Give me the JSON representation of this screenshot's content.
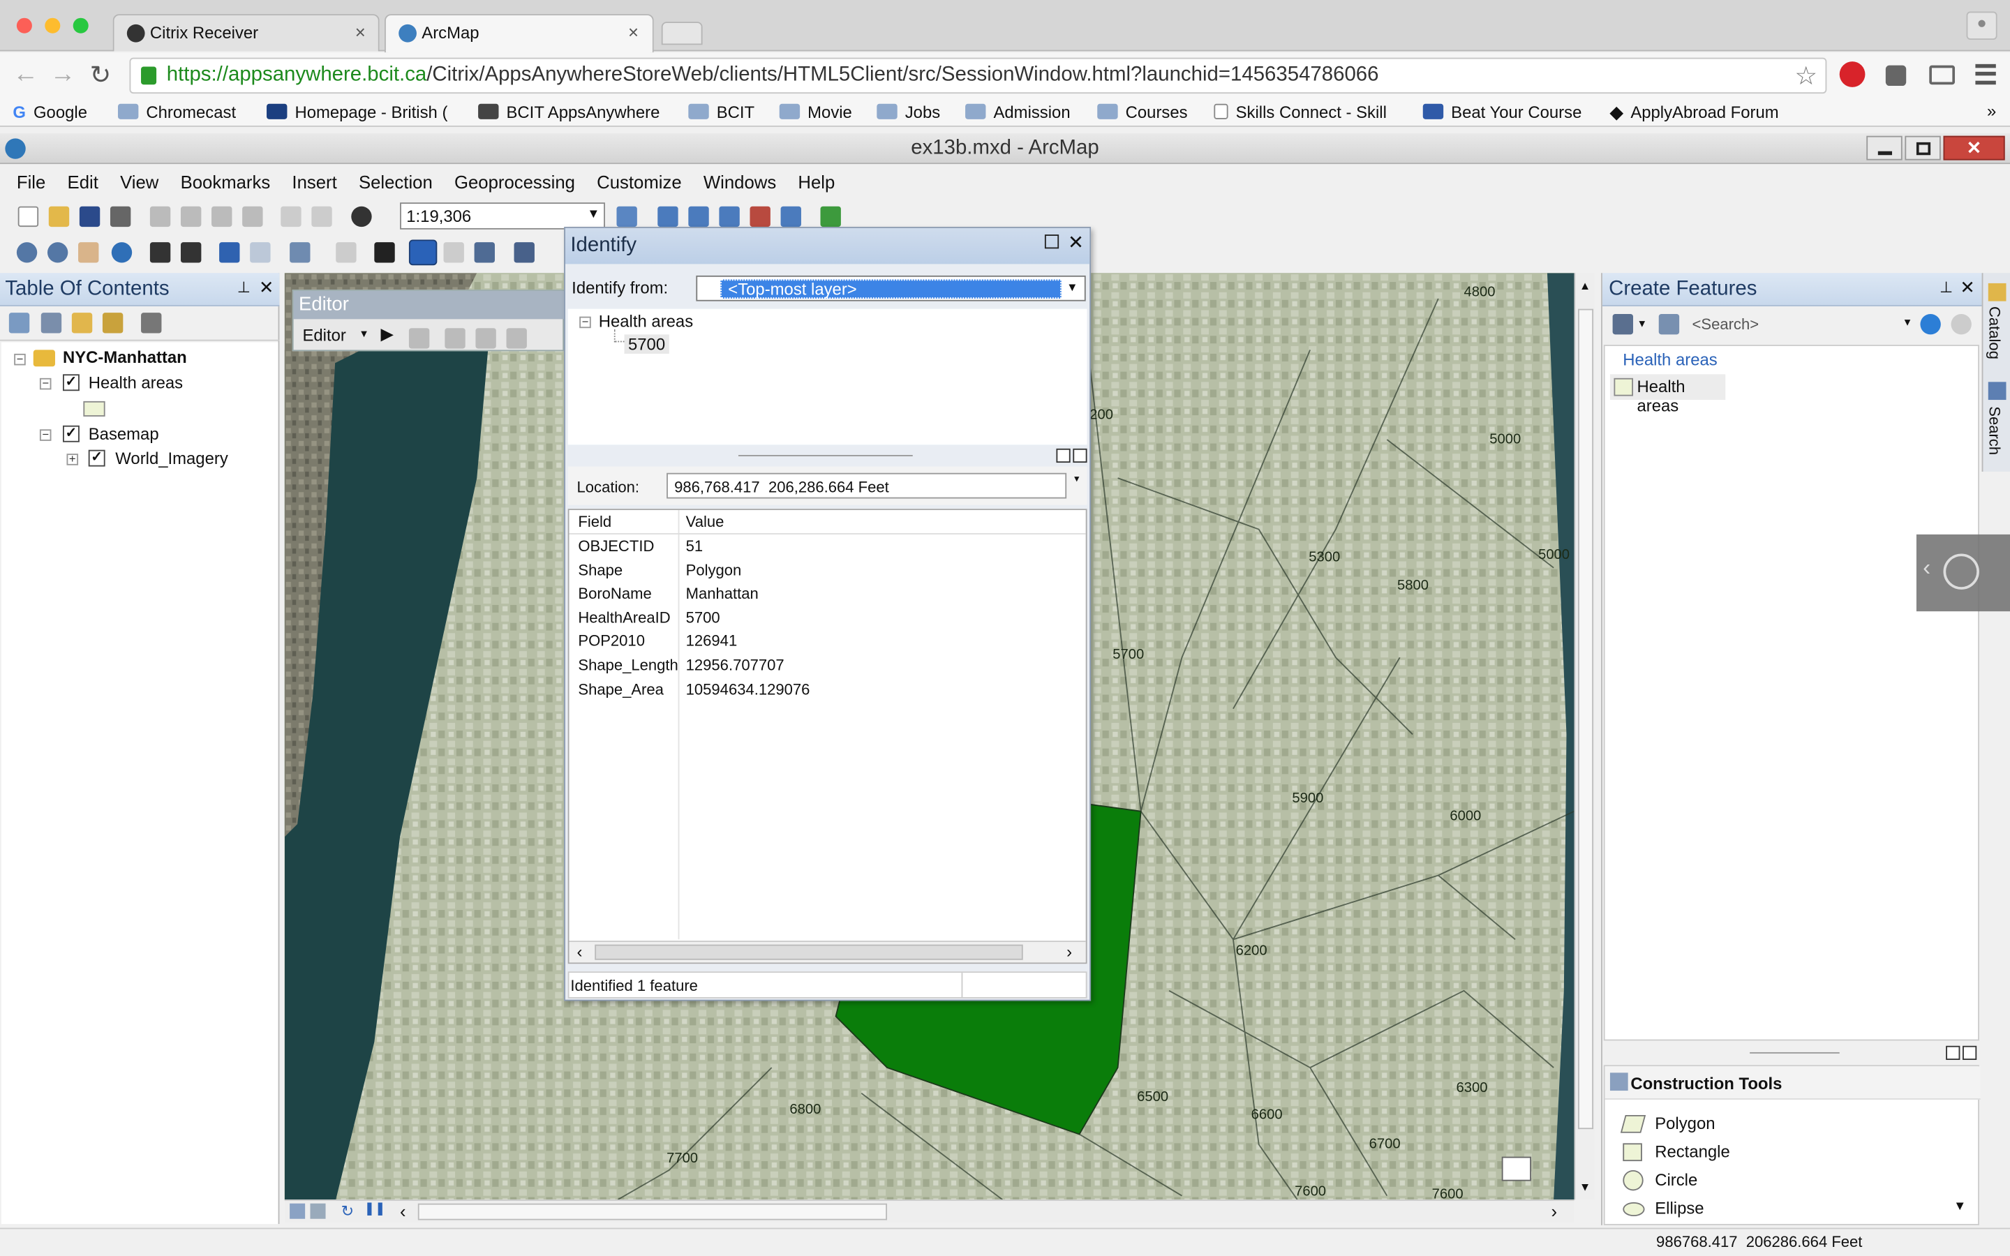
{
  "browser": {
    "tabs": [
      {
        "title": "Citrix Receiver"
      },
      {
        "title": "ArcMap"
      }
    ],
    "url_host": "https://appsanywhere.bcit.ca",
    "url_path": "/Citrix/AppsAnywhereStoreWeb/clients/HTML5Client/src/SessionWindow.html?launchid=1456354786066",
    "bookmarks": [
      "Google",
      "Chromecast",
      "Homepage - British (",
      "BCIT AppsAnywhere",
      "BCIT",
      "Movie",
      "Jobs",
      "Admission",
      "Courses",
      "Skills Connect - Skill",
      "Beat Your Course",
      "ApplyAbroad Forum"
    ]
  },
  "window": {
    "title": "ex13b.mxd - ArcMap"
  },
  "menu": [
    "File",
    "Edit",
    "View",
    "Bookmarks",
    "Insert",
    "Selection",
    "Geoprocessing",
    "Customize",
    "Windows",
    "Help"
  ],
  "toolbar": {
    "scale": "1:19,306"
  },
  "toc": {
    "title": "Table Of Contents",
    "root": "NYC-Manhattan",
    "layer1": "Health areas",
    "group": "Basemap",
    "layer2": "World_Imagery"
  },
  "editor": {
    "title": "Editor",
    "menu": "Editor"
  },
  "identify": {
    "title": "Identify",
    "from_label": "Identify from:",
    "from_value": "<Top-most layer>",
    "tree_layer": "Health areas",
    "tree_feature": "5700",
    "location_label": "Location:",
    "location_value": "986,768.417  206,286.664 Feet",
    "col_field": "Field",
    "col_value": "Value",
    "rows": [
      {
        "field": "OBJECTID",
        "value": "51"
      },
      {
        "field": "Shape",
        "value": "Polygon"
      },
      {
        "field": "BoroName",
        "value": "Manhattan"
      },
      {
        "field": "HealthAreaID",
        "value": "5700"
      },
      {
        "field": "POP2010",
        "value": "126941"
      },
      {
        "field": "Shape_Length",
        "value": "12956.707707"
      },
      {
        "field": "Shape_Area",
        "value": "10594634.129076"
      }
    ],
    "status": "Identified 1 feature"
  },
  "map_labels": [
    "4800",
    "200",
    "5000",
    "5300",
    "5800",
    "5000",
    "5700",
    "5900",
    "6000",
    "6200",
    "6500",
    "6600",
    "6300",
    "6800",
    "6700",
    "7700",
    "7600",
    "7600"
  ],
  "create_features": {
    "title": "Create Features",
    "search_placeholder": "<Search>",
    "group": "Health areas",
    "template": "Health areas",
    "construction_title": "Construction Tools",
    "tools": [
      "Polygon",
      "Rectangle",
      "Circle",
      "Ellipse"
    ]
  },
  "side_tabs": {
    "catalog": "Catalog",
    "search": "Search"
  },
  "status_bar": {
    "coords": "986768.417  206286.664 Feet"
  },
  "colors": {
    "selected_polygon": "#0a7d0a",
    "highlight": "#3c84e6"
  }
}
